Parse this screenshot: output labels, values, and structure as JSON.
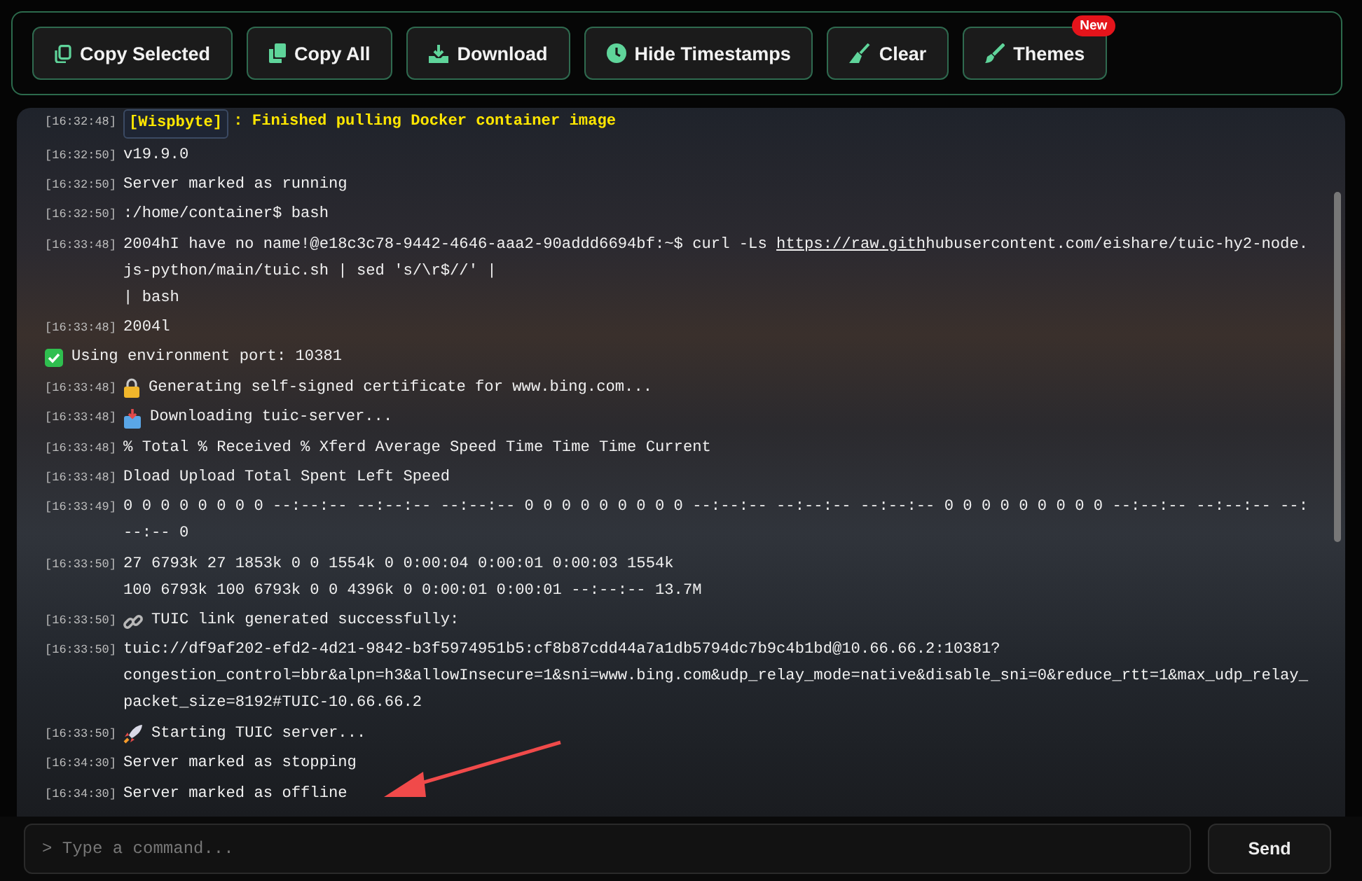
{
  "toolbar": {
    "buttons": [
      {
        "kind": "copy",
        "label": "Copy Selected"
      },
      {
        "kind": "copyall",
        "label": "Copy All"
      },
      {
        "kind": "download",
        "label": "Download"
      },
      {
        "kind": "clock",
        "label": "Hide Timestamps"
      },
      {
        "kind": "clear",
        "label": "Clear"
      },
      {
        "kind": "brush",
        "label": "Themes",
        "badge": "New"
      }
    ]
  },
  "log": [
    {
      "kind": "notice",
      "time": "[16:32:48]",
      "tag": "[Wispbyte]",
      "text": ": Finished pulling Docker container image"
    },
    {
      "kind": "plain",
      "time": "[16:32:50]",
      "text": "v19.9.0"
    },
    {
      "kind": "plain",
      "time": "[16:32:50]",
      "text": "Server marked as running"
    },
    {
      "kind": "plain",
      "time": "[16:32:50]",
      "text": ":/home/container$ bash"
    },
    {
      "kind": "plain",
      "time": "[16:33:48]",
      "text": "2004hI have no name!@e18c3c78-9442-4646-aaa2-90addd6694bf:~$ curl -Ls ",
      "link": "https://raw.gith",
      "after": "hubusercontent.com/eishare/tuic-hy2-node.js-python/main/tuic.sh | sed 's/\\r$//' |\n| bash"
    },
    {
      "kind": "plain",
      "time": "[16:33:48]",
      "text": "2004l"
    },
    {
      "kind": "success",
      "text": "Using environment port: 10381"
    },
    {
      "kind": "lock",
      "time": "[16:33:48]",
      "text": "Generating self-signed certificate for www.bing.com..."
    },
    {
      "kind": "inbox",
      "time": "[16:33:48]",
      "text": "Downloading tuic-server..."
    },
    {
      "kind": "plain",
      "time": "[16:33:48]",
      "text": "% Total % Received % Xferd Average Speed Time Time Time Current"
    },
    {
      "kind": "plain",
      "time": "[16:33:48]",
      "text": "Dload Upload Total Spent Left Speed"
    },
    {
      "kind": "plain",
      "time": "[16:33:49]",
      "text": "0 0 0 0 0 0 0 0 --:--:-- --:--:-- --:--:-- 0 0 0 0 0 0 0 0 0 --:--:-- --:--:-- --:--:-- 0 0 0 0 0 0 0 0 0 --:--:-- --:--:-- --:--:-- 0"
    },
    {
      "kind": "plain",
      "time": "[16:33:50]",
      "text": "27 6793k 27 1853k 0 0 1554k 0 0:00:04 0:00:01 0:00:03 1554k\n100 6793k 100 6793k 0 0 4396k 0 0:00:01 0:00:01 --:--:-- 13.7M"
    },
    {
      "kind": "link",
      "time": "[16:33:50]",
      "text": "TUIC link generated successfully:"
    },
    {
      "kind": "plain",
      "time": "[16:33:50]",
      "text": "tuic://df9af202-efd2-4d21-9842-b3f5974951b5:cf8b87cdd44a7a1db5794dc7b9c4b1bd@10.66.66.2:10381?\ncongestion_control=bbr&alpn=h3&allowInsecure=1&sni=www.bing.com&udp_relay_mode=native&disable_sni=0&reduce_rtt=1&max_udp_relay_packet_size=8192#TUIC-10.66.66.2"
    },
    {
      "kind": "rocket",
      "time": "[16:33:50]",
      "text": "Starting TUIC server..."
    },
    {
      "kind": "plain",
      "time": "[16:34:30]",
      "text": "Server marked as stopping"
    },
    {
      "kind": "plain",
      "time": "[16:34:30]",
      "text": "Server marked as offline"
    }
  ],
  "command": {
    "placeholder": "> Type a command...",
    "button": "Send"
  }
}
